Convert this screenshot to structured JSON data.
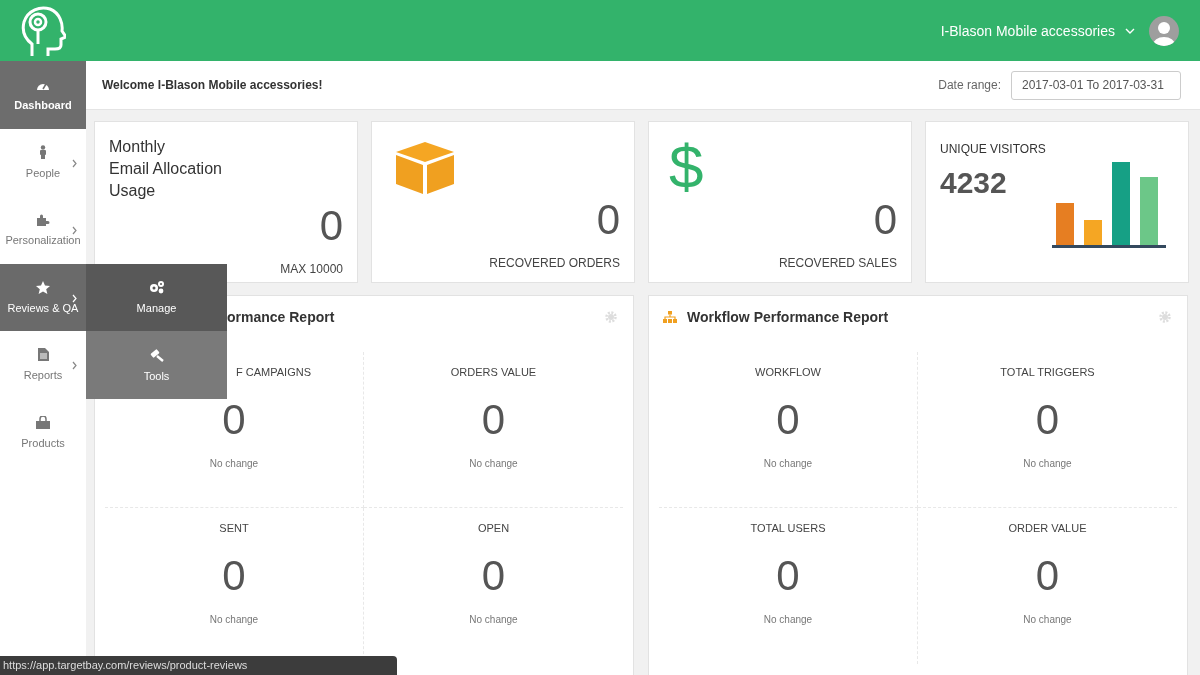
{
  "header": {
    "account": "I-Blason Mobile accessories"
  },
  "sidebar": {
    "items": [
      {
        "label": "Dashboard",
        "selected": true,
        "has_submenu": false
      },
      {
        "label": "People",
        "selected": false,
        "has_submenu": true
      },
      {
        "label": "Personalization",
        "selected": false,
        "has_submenu": true
      },
      {
        "label": "Reviews & QA",
        "selected": false,
        "has_submenu": true,
        "expanded": true,
        "children": [
          {
            "label": "Manage",
            "selected": true
          },
          {
            "label": "Tools",
            "selected": false
          }
        ]
      },
      {
        "label": "Reports",
        "selected": false,
        "has_submenu": true
      },
      {
        "label": "Products",
        "selected": false,
        "has_submenu": false
      }
    ]
  },
  "welcome": "Welcome I-Blason Mobile accessories!",
  "date_range": {
    "label": "Date range:",
    "value": "2017-03-01 To 2017-03-31"
  },
  "cards": [
    {
      "kind": "allocation",
      "title": [
        "Monthly",
        "Email Allocation",
        "Usage"
      ],
      "value": "0",
      "caption": "MAX 10000"
    },
    {
      "kind": "box",
      "value": "0",
      "caption": "RECOVERED ORDERS"
    },
    {
      "kind": "dollar",
      "symbol": "$",
      "value": "0",
      "caption": "RECOVERED SALES"
    },
    {
      "kind": "visitors",
      "title": "UNIQUE VISITORS",
      "value": "4232"
    }
  ],
  "panels": [
    {
      "title": "ormance Report",
      "stats": [
        {
          "label": "F CAMPAIGNS",
          "value": "0",
          "change": "No change"
        },
        {
          "label": "ORDERS VALUE",
          "value": "0",
          "change": "No change"
        },
        {
          "label": "SENT",
          "value": "0",
          "change": "No change"
        },
        {
          "label": "OPEN",
          "value": "0",
          "change": "No change"
        }
      ]
    },
    {
      "title": "Workflow Performance Report",
      "stats": [
        {
          "label": "WORKFLOW",
          "value": "0",
          "change": "No change"
        },
        {
          "label": "TOTAL TRIGGERS",
          "value": "0",
          "change": "No change"
        },
        {
          "label": "TOTAL USERS",
          "value": "0",
          "change": "No change"
        },
        {
          "label": "ORDER VALUE",
          "value": "0",
          "change": "No change"
        }
      ]
    }
  ],
  "status_bar": {
    "url": "https://app.targetbay.com/reviews/product-reviews"
  }
}
